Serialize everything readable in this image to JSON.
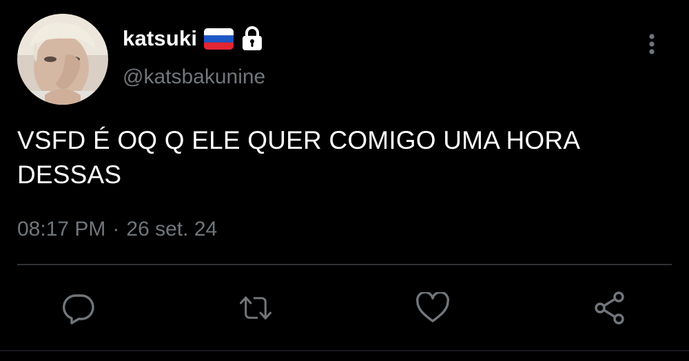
{
  "user": {
    "display_name": "katsuki",
    "handle": "@katsbakunine",
    "badges": [
      "russia-flag-emoji",
      "lock-icon"
    ],
    "avatar": "profile-photo"
  },
  "tweet": {
    "text": "VSFD É OQ Q ELE QUER COMIGO UMA HORA DESSAS",
    "time": "08:17 PM",
    "separator": "·",
    "date": "26 set. 24"
  },
  "actions": [
    "reply-icon",
    "retweet-icon",
    "like-icon",
    "share-icon"
  ],
  "colors": {
    "background": "#000000",
    "text": "#ffffff",
    "muted": "#71767b",
    "divider": "#2f3336"
  }
}
